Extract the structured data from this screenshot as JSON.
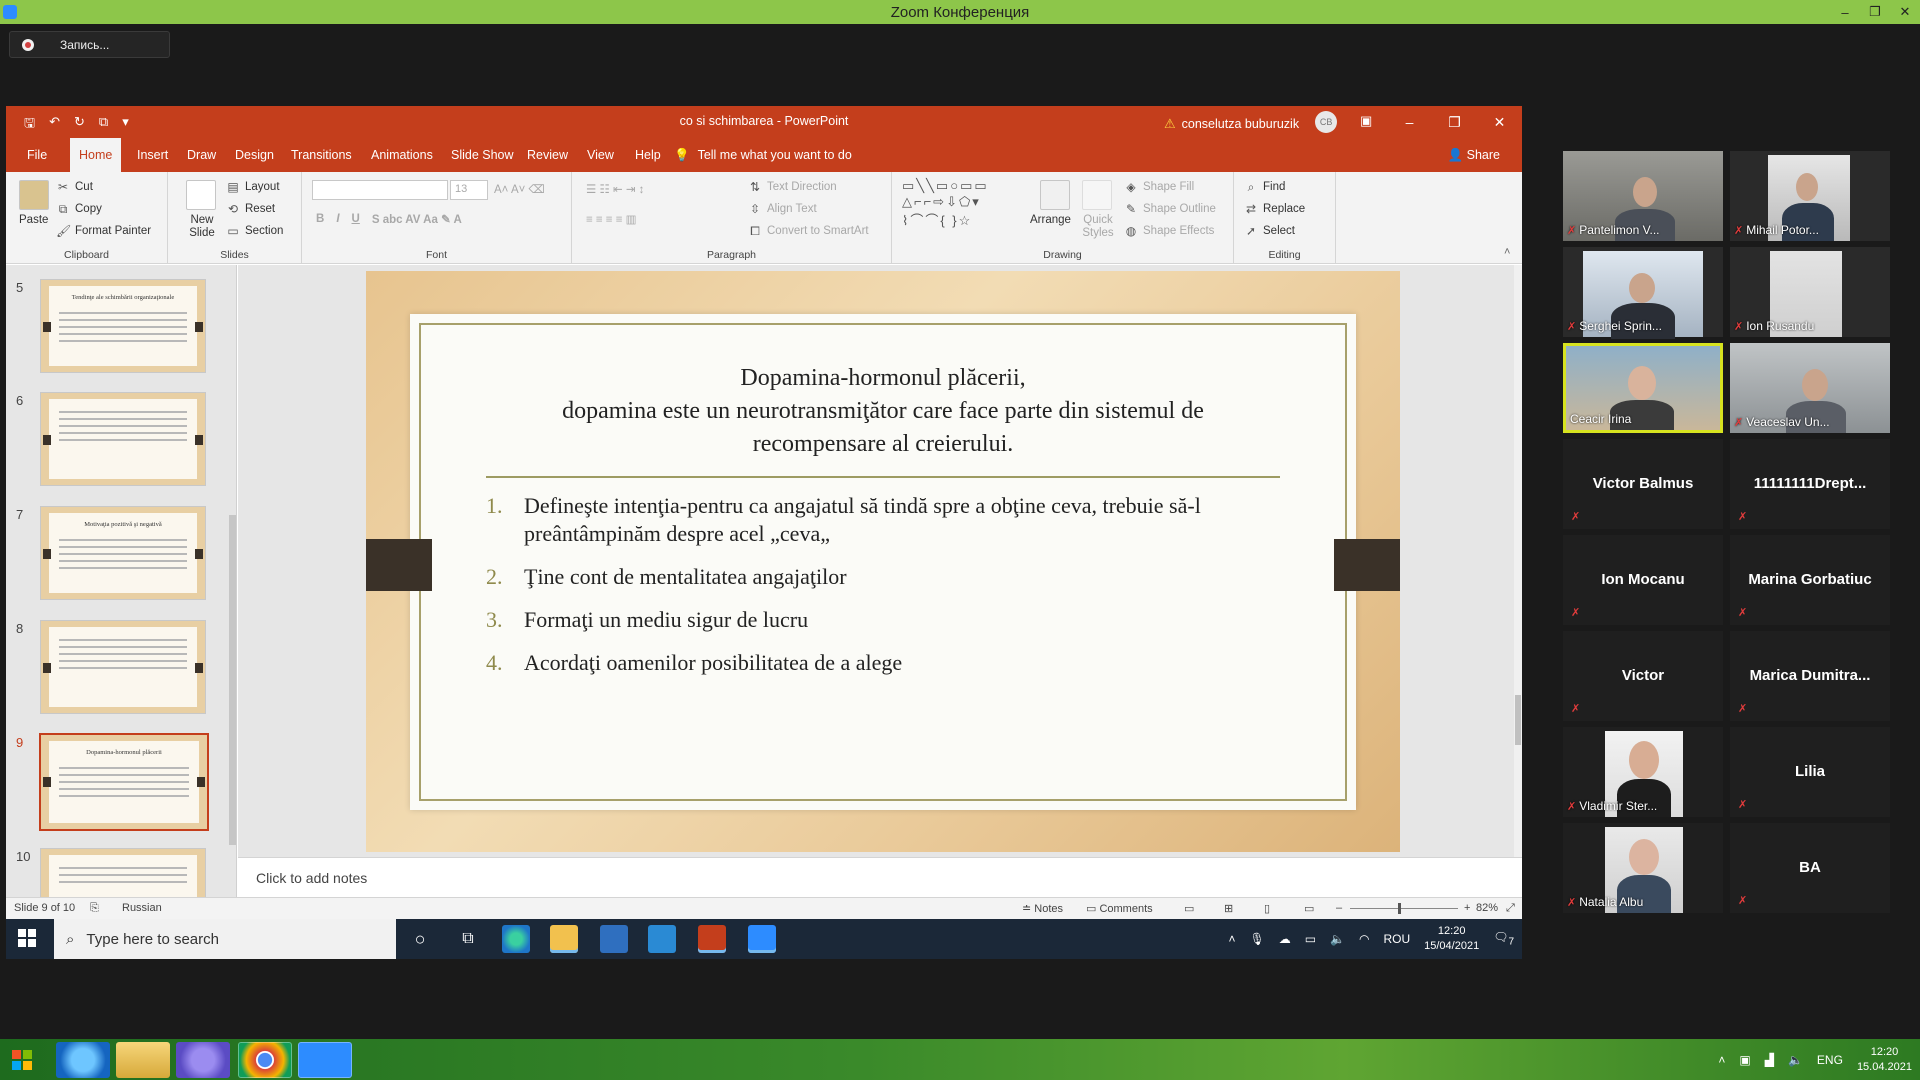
{
  "zoom": {
    "title": "Zoom Конференция",
    "recording_label": "Запись...",
    "window_controls": [
      "–",
      "❐",
      "✕"
    ]
  },
  "ppt": {
    "doc_title": "co si schimbarea  -  PowerPoint",
    "user_name": "conselutza buburuzik",
    "user_initials": "CB",
    "tabs": [
      "File",
      "Home",
      "Insert",
      "Draw",
      "Design",
      "Transitions",
      "Animations",
      "Slide Show",
      "Review",
      "View",
      "Help"
    ],
    "active_tab": "Home",
    "tell_me": "Tell me what you want to do",
    "share": "Share",
    "ribbon": {
      "clipboard": {
        "paste": "Paste",
        "cut": "Cut",
        "copy": "Copy",
        "format_painter": "Format Painter",
        "label": "Clipboard"
      },
      "slides": {
        "new_slide": "New Slide",
        "layout": "Layout",
        "reset": "Reset",
        "section": "Section",
        "label": "Slides"
      },
      "font": {
        "size": "13",
        "label": "Font"
      },
      "paragraph": {
        "text_direction": "Text Direction",
        "align_text": "Align Text",
        "convert": "Convert to SmartArt",
        "label": "Paragraph"
      },
      "drawing": {
        "arrange": "Arrange",
        "quick_styles": "Quick Styles",
        "shape_fill": "Shape Fill",
        "shape_outline": "Shape Outline",
        "shape_effects": "Shape Effects",
        "label": "Drawing"
      },
      "editing": {
        "find": "Find",
        "replace": "Replace",
        "select": "Select",
        "label": "Editing"
      }
    },
    "thumbnails": [
      {
        "num": "5",
        "title": "Tendinţe ale schimbării organizaţionale"
      },
      {
        "num": "6",
        "title": ""
      },
      {
        "num": "7",
        "title": "Motivaţia pozitivă şi negativă"
      },
      {
        "num": "8",
        "title": ""
      },
      {
        "num": "9",
        "title": "Dopamina-hormonul plăcerii"
      },
      {
        "num": "10",
        "title": ""
      }
    ],
    "selected_slide": "9",
    "slide": {
      "title_line1": "Dopamina-hormonul plăcerii,",
      "title_line2": "dopamina este un neurotransmiţător care face parte din sistemul de",
      "title_line3": "recompensare al creierului.",
      "bullets": [
        {
          "n": "1.",
          "text": "Defineşte intenţia-pentru ca angajatul să tindă spre a obţine ceva, trebuie să-l preântâmpinăm despre acel „ceva„"
        },
        {
          "n": "2.",
          "text": "Ţine cont de mentalitatea angajaţilor"
        },
        {
          "n": "3.",
          "text": "Formaţi un mediu sigur de lucru"
        },
        {
          "n": "4.",
          "text": "Acordaţi oamenilor posibilitatea de a alege"
        }
      ]
    },
    "notes_placeholder": "Click to add notes",
    "status": {
      "slide_of": "Slide 9 of 10",
      "language": "Russian",
      "notes": "Notes",
      "comments": "Comments",
      "zoom": "82%"
    }
  },
  "inner_taskbar": {
    "search_placeholder": "Type here to search",
    "lang": "ROU",
    "time": "12:20",
    "date": "15/04/2021",
    "notif_count": "7"
  },
  "participants": [
    {
      "name": "Pantelimon V...",
      "video": true
    },
    {
      "name": "Mihail Potor...",
      "video": true
    },
    {
      "name": "Serghei Sprin...",
      "video": true
    },
    {
      "name": "Ion Rusandu",
      "video": true
    },
    {
      "name": "Ceacir Irina",
      "video": true,
      "speaking": true
    },
    {
      "name": "Veaceslav Un...",
      "video": true
    },
    {
      "name": "Victor Balmus",
      "video": false
    },
    {
      "name": "11111111Drept...",
      "video": false
    },
    {
      "name": "Ion Mocanu",
      "video": false
    },
    {
      "name": "Marina Gorbatiuc",
      "video": false
    },
    {
      "name": "Victor",
      "video": false
    },
    {
      "name": "Marica  Dumitra...",
      "video": false
    },
    {
      "name": "Vladimir Ster...",
      "video": true
    },
    {
      "name": "Lilia",
      "video": false
    },
    {
      "name": "Natalia Albu",
      "video": true
    },
    {
      "name": "BA",
      "video": false
    }
  ],
  "host_taskbar": {
    "lang": "ENG",
    "time": "12:20",
    "date": "15.04.2021"
  },
  "colors": {
    "zoom_titlebar": "#8dc64a",
    "ppt_accent": "#c43e1c",
    "speaking_border": "#d7e31f",
    "muted_mic": "#e23c3c"
  }
}
